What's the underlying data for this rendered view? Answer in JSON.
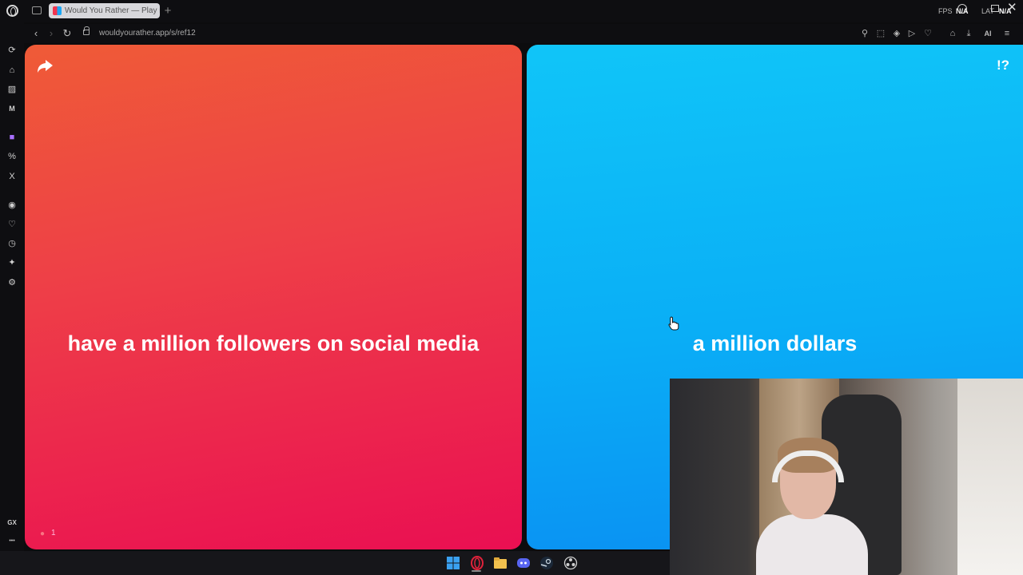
{
  "browser": {
    "tab_title": "Would You Rather — Play it",
    "new_tab": "+",
    "url": "wouldyourather.app/s/ref12",
    "ai_label": "AI"
  },
  "overlay": {
    "fps_label": "FPS",
    "fps_value": "N/A",
    "lat_label": "LAT",
    "lat_value": "N/A"
  },
  "sidebar": {
    "gx_label": "GX",
    "more_label": "•••"
  },
  "game": {
    "option_left": "have a million followers on social media",
    "option_right": "a million dollars",
    "help_symbol": "!?",
    "like_count": "1"
  },
  "colors": {
    "left_top": "#ef5b37",
    "left_bottom": "#ea0f52",
    "right_top": "#10c5f8",
    "right_bottom": "#0a8ff2"
  }
}
